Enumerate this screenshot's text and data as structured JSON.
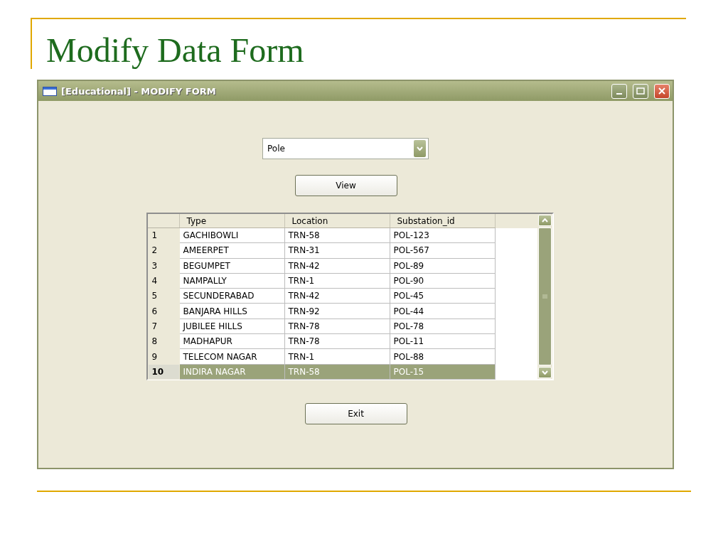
{
  "slide": {
    "title": "Modify Data Form"
  },
  "window": {
    "title": "[Educational] - MODIFY FORM"
  },
  "dropdown": {
    "value": "Pole"
  },
  "view_button": {
    "label": "View"
  },
  "grid": {
    "columns": [
      "Type",
      "Location",
      "Substation_id"
    ],
    "rows": [
      {
        "number": "1",
        "cells": [
          "GACHIBOWLI",
          "TRN-58",
          "POL-123"
        ],
        "selected": false
      },
      {
        "number": "2",
        "cells": [
          "AMEERPET",
          "TRN-31",
          "POL-567"
        ],
        "selected": false
      },
      {
        "number": "3",
        "cells": [
          "BEGUMPET",
          "TRN-42",
          "POL-89"
        ],
        "selected": false
      },
      {
        "number": "4",
        "cells": [
          "NAMPALLY",
          "TRN-1",
          "POL-90"
        ],
        "selected": false
      },
      {
        "number": "5",
        "cells": [
          "SECUNDERABAD",
          "TRN-42",
          "POL-45"
        ],
        "selected": false
      },
      {
        "number": "6",
        "cells": [
          "BANJARA HILLS",
          "TRN-92",
          "POL-44"
        ],
        "selected": false
      },
      {
        "number": "7",
        "cells": [
          "JUBILEE HILLS",
          "TRN-78",
          "POL-78"
        ],
        "selected": false
      },
      {
        "number": "8",
        "cells": [
          "MADHAPUR",
          "TRN-78",
          "POL-11"
        ],
        "selected": false
      },
      {
        "number": "9",
        "cells": [
          "TELECOM NAGAR",
          "TRN-1",
          "POL-88"
        ],
        "selected": false
      },
      {
        "number": "10",
        "cells": [
          "INDIRA NAGAR",
          "TRN-58",
          "POL-15"
        ],
        "selected": true
      }
    ]
  },
  "exit_button": {
    "label": "Exit"
  }
}
